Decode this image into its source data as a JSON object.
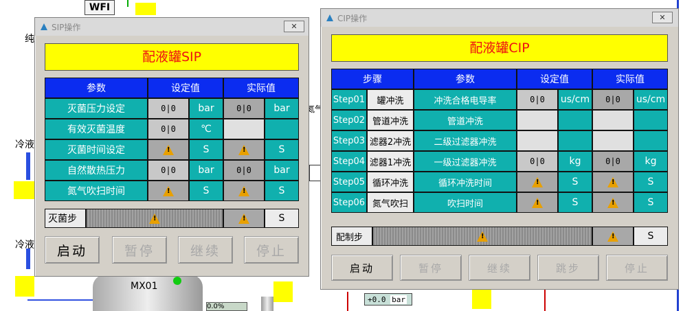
{
  "background": {
    "wfi_label": "WFI",
    "pure_label": "纯",
    "cold_label_1": "冷液",
    "cold_label_2": "冷液",
    "tank_label": "MX01",
    "nitrogen_label": "氮气",
    "readout_value": "+0.0",
    "readout_unit": "bar",
    "pct_value": "0.0",
    "pct_unit": "%"
  },
  "sip": {
    "window_title": "SIP操作",
    "close_label": "✕",
    "banner": "配液罐SIP",
    "headers": [
      "参数",
      "设定值",
      "实际值"
    ],
    "rows": [
      {
        "label": "灭菌压力设定",
        "set": "0|0",
        "set_unit": "bar",
        "act": "0|0",
        "act_unit": "bar"
      },
      {
        "label": "有效灭菌温度",
        "set": "0|0",
        "set_unit": "℃",
        "act": "",
        "act_unit": ""
      },
      {
        "label": "灭菌时间设定",
        "set": "warn",
        "set_unit": "S",
        "act": "warn",
        "act_unit": "S"
      },
      {
        "label": "自然散热压力",
        "set": "0|0",
        "set_unit": "bar",
        "act": "0|0",
        "act_unit": "bar"
      },
      {
        "label": "氮气吹扫时间",
        "set": "warn",
        "set_unit": "S",
        "act": "warn",
        "act_unit": "S"
      }
    ],
    "step_label": "灭菌步",
    "step_unit": "S",
    "buttons": {
      "start": "启动",
      "pause": "暂停",
      "continue": "继续",
      "stop": "停止"
    }
  },
  "cip": {
    "window_title": "CIP操作",
    "close_label": "✕",
    "banner": "配液罐CIP",
    "headers": [
      "步骤",
      "参数",
      "设定值",
      "实际值"
    ],
    "rows": [
      {
        "step": "Step01",
        "name": "罐冲洗",
        "param": "冲洗合格电导率",
        "set": "0|0",
        "set_unit": "us/cm",
        "act": "0|0",
        "act_unit": "us/cm"
      },
      {
        "step": "Step02",
        "name": "管道冲洗",
        "param": "管道冲洗",
        "set": "",
        "set_unit": "",
        "act": "",
        "act_unit": ""
      },
      {
        "step": "Step03",
        "name": "滤器2冲洗",
        "param": "二级过滤器冲洗",
        "set": "",
        "set_unit": "",
        "act": "",
        "act_unit": ""
      },
      {
        "step": "Step04",
        "name": "滤器1冲洗",
        "param": "一级过滤器冲洗",
        "set": "0|0",
        "set_unit": "kg",
        "act": "0|0",
        "act_unit": "kg"
      },
      {
        "step": "Step05",
        "name": "循环冲洗",
        "param": "循环冲洗时间",
        "set": "warn",
        "set_unit": "S",
        "act": "warn",
        "act_unit": "S"
      },
      {
        "step": "Step06",
        "name": "氮气吹扫",
        "param": "吹扫时间",
        "set": "warn",
        "set_unit": "S",
        "act": "warn",
        "act_unit": "S"
      }
    ],
    "step_label": "配制步",
    "step_unit": "S",
    "buttons": {
      "start": "启动",
      "pause": "暂停",
      "continue": "继续",
      "skip": "跳步",
      "stop": "停止"
    }
  }
}
